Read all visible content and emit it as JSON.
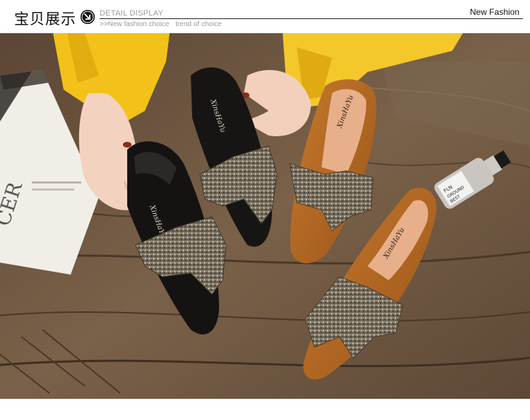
{
  "header": {
    "title": "宝贝展示",
    "detail_label": "DETAIL DISPLAY",
    "subtitle_1": ">>New fashion choice",
    "subtitle_2": "trend of choice",
    "right_label": "New Fashion",
    "arrow_icon": "circle-arrow-down-right-icon"
  },
  "photo": {
    "shoe_brand_text": "XinsHaYu",
    "book_text": "CER",
    "bottle_text_1": "FLN",
    "bottle_text_2": "GROUND",
    "bottle_text_3": "BEST"
  },
  "colors": {
    "wood": "#6b5642",
    "sleeve": "#f2c21b",
    "black_suede": "#151312",
    "brown_suede": "#b2641f",
    "sparkle": "#a99c88"
  }
}
